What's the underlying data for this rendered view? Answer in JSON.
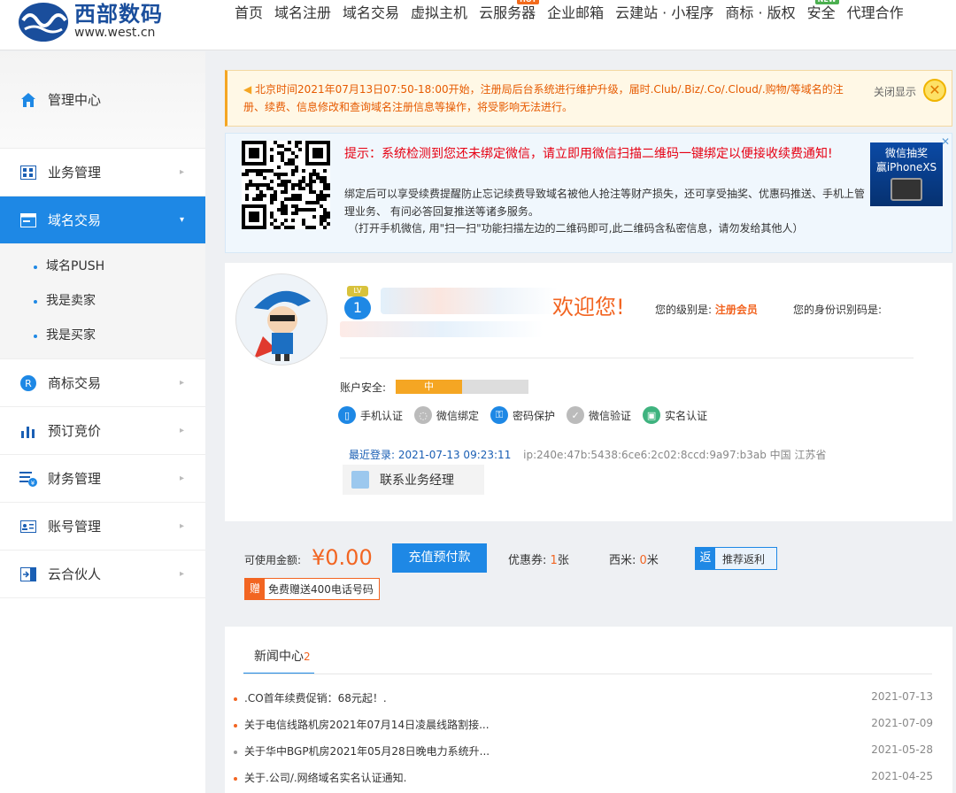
{
  "header": {
    "logo_cn": "西部数码",
    "logo_en": "www.west.cn",
    "nav": [
      {
        "label": "首页"
      },
      {
        "label": "域名注册"
      },
      {
        "label": "域名交易"
      },
      {
        "label": "虚拟主机"
      },
      {
        "label": "云服务器",
        "badge": "HOT"
      },
      {
        "label": "企业邮箱"
      },
      {
        "label": "云建站 · 小程序"
      },
      {
        "label": "商标 · 版权"
      },
      {
        "label": "安全",
        "badge": "NEW"
      },
      {
        "label": "代理合作"
      }
    ]
  },
  "sidebar": {
    "items": [
      {
        "label": "管理中心",
        "icon": "home-icon"
      },
      {
        "label": "业务管理",
        "icon": "grid-icon"
      },
      {
        "label": "域名交易",
        "icon": "domain-icon",
        "active": true
      },
      {
        "label": "商标交易",
        "icon": "trademark-icon"
      },
      {
        "label": "预订竞价",
        "icon": "bar-chart-icon"
      },
      {
        "label": "财务管理",
        "icon": "finance-icon"
      },
      {
        "label": "账号管理",
        "icon": "account-card-icon"
      },
      {
        "label": "云合伙人",
        "icon": "partner-icon"
      }
    ],
    "sub_items": [
      "域名PUSH",
      "我是卖家",
      "我是买家"
    ]
  },
  "notice": {
    "text": "北京时间2021年07月13日07:50-18:00开始，注册局后台系统进行维护升级，届时.Club/.Biz/.Co/.Cloud/.购物/等域名的注册、续费、信息修改和查询域名注册信息等操作，将受影响无法进行。",
    "close_label": "关闭显示"
  },
  "wechat": {
    "title": "提示：系统检测到您还未绑定微信，请立即用微信扫描二维码一键绑定以便接收续费通知!",
    "desc": "绑定后可以享受续费提醒防止忘记续费导致域名被他人抢注等财产损失，还可享受抽奖、优惠码推送、手机上管理业务、 有问必答回复推送等诸多服务。",
    "tip": "（打开手机微信, 用\"扫一扫\"功能扫描左边的二维码即可,此二维码含私密信息，请勿发给其他人）",
    "promo_line1": "微信抽奖",
    "promo_line2": "赢iPhoneXS"
  },
  "user": {
    "lv_tag": "LV",
    "lv_num": "1",
    "welcome": "欢迎您!",
    "level_label": "您的级别是:",
    "level_value": "注册会员",
    "id_label": "您的身份识别码是:",
    "safety_label": "账户安全:",
    "safety_level": "中",
    "safety_fraction": 0.5,
    "verifications": [
      {
        "label": "手机认证",
        "color": "#1e88e5"
      },
      {
        "label": "微信绑定",
        "color": "#bbbbbb"
      },
      {
        "label": "密码保护",
        "color": "#1e88e5"
      },
      {
        "label": "微信验证",
        "color": "#bbbbbb"
      },
      {
        "label": "实名认证",
        "color": "#3fb37f"
      }
    ],
    "last_login_label": "最近登录:",
    "last_login_time": "2021-07-13 09:23:11",
    "last_login_ip": "ip:240e:47b:5438:6ce6:2c02:8ccd:9a97:b3ab  中国 江苏省",
    "manager_label": "联系业务经理"
  },
  "balance": {
    "label": "可使用金额:",
    "value": "¥0.00",
    "recharge_label": "充值预付款",
    "coupon_label": "优惠券:",
    "coupon_value": "1",
    "coupon_unit": "张",
    "xm_label": "西米:",
    "xm_value": "0",
    "xm_unit": "米",
    "rebate_icon": "返",
    "rebate_label": "推荐返利",
    "gift_icon": "赠",
    "gift_label": "免费赠送400电话号码"
  },
  "news": {
    "tab_label": "新闻中心",
    "tab_count": "2",
    "items": [
      {
        "title": ".CO首年续费促销：68元起！.",
        "date": "2021-07-13",
        "dot": "#f26522"
      },
      {
        "title": "关于电信线路机房2021年07月14日凌晨线路割接...",
        "date": "2021-07-09",
        "dot": "#f26522"
      },
      {
        "title": "关于华中BGP机房2021年05月28日晚电力系统升...",
        "date": "2021-05-28",
        "dot": "#999999"
      },
      {
        "title": "关于.公司/.网络域名实名认证通知.",
        "date": "2021-04-25",
        "dot": "#f26522"
      }
    ]
  },
  "colors": {
    "accent": "#1e88e5",
    "orange": "#f26522"
  }
}
